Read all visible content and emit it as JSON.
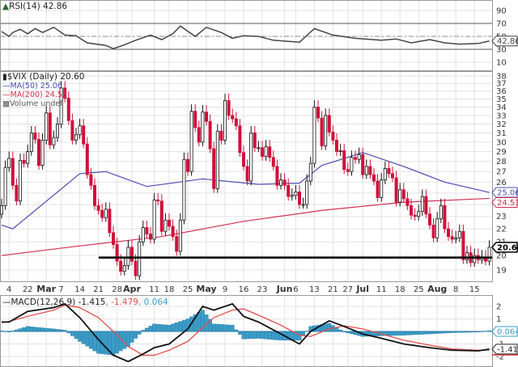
{
  "chart_data": [
    {
      "type": "line",
      "panel": "RSI",
      "title": "RSI(14) 42.86",
      "ylim": [
        0,
        100
      ],
      "yticks": [
        90,
        70,
        50,
        30,
        10
      ],
      "reference_lines": [
        70,
        30
      ],
      "last_value": "42.86",
      "series": [
        {
          "values": [
            [
              "02-10",
              57.5
            ],
            [
              "02-14",
              50
            ],
            [
              "02-15",
              56
            ],
            [
              "02-17",
              61
            ],
            [
              "02-22",
              54
            ],
            [
              "02-24",
              62
            ],
            [
              "02-28",
              56
            ],
            [
              "03-03",
              64
            ],
            [
              "03-08",
              52
            ],
            [
              "03-11",
              51
            ],
            [
              "03-16",
              40
            ],
            [
              "03-23",
              36
            ],
            [
              "03-25",
              31
            ],
            [
              "03-30",
              37
            ],
            [
              "04-04",
              44
            ],
            [
              "04-08",
              52
            ],
            [
              "04-13",
              45
            ],
            [
              "04-19",
              54
            ],
            [
              "04-21",
              66
            ],
            [
              "04-27",
              50
            ],
            [
              "05-02",
              64
            ],
            [
              "05-06",
              56
            ],
            [
              "05-11",
              47
            ],
            [
              "05-16",
              51
            ],
            [
              "05-20",
              50
            ],
            [
              "05-26",
              44
            ],
            [
              "06-07",
              41
            ],
            [
              "06-13",
              62
            ],
            [
              "06-21",
              52
            ],
            [
              "06-29",
              47
            ],
            [
              "07-11",
              44
            ],
            [
              "07-15",
              46
            ],
            [
              "07-21",
              40
            ],
            [
              "07-28",
              45
            ],
            [
              "08-03",
              40
            ],
            [
              "08-09",
              38
            ],
            [
              "08-16",
              39
            ],
            [
              "08-19",
              42.86
            ]
          ]
        }
      ]
    },
    {
      "type": "candlestick",
      "panel": "price",
      "title": "$VIX (Daily) 20.60",
      "scale": "log",
      "ylim": [
        18.6,
        38.5
      ],
      "yticks": [
        19,
        20,
        21,
        22,
        23,
        24,
        25,
        26,
        27,
        28,
        29,
        30,
        31,
        32,
        33,
        34,
        35,
        36,
        37,
        38
      ],
      "grid": true,
      "last_value": "20.60",
      "support_line": 19.85,
      "legend": [
        {
          "label": "MA(50) 25.06",
          "color": "#4b4bb0"
        },
        {
          "label": "MA(200) 24.53",
          "color": "#d03050"
        },
        {
          "label": "Volume undef",
          "color": "#555555"
        }
      ],
      "ma50_tag": "25.06",
      "ma200_tag": "24.53",
      "closes": [
        [
          "02-10",
          23.9
        ],
        [
          "02-11",
          27.4
        ],
        [
          "02-14",
          28.3
        ],
        [
          "02-15",
          25.7
        ],
        [
          "02-16",
          24.3
        ],
        [
          "02-17",
          28.1
        ],
        [
          "02-18",
          27.8
        ],
        [
          "02-22",
          29.0
        ],
        [
          "02-23",
          31.0
        ],
        [
          "02-24",
          30.3
        ],
        [
          "02-25",
          27.6
        ],
        [
          "02-28",
          30.2
        ],
        [
          "03-01",
          33.3
        ],
        [
          "03-02",
          29.7
        ],
        [
          "03-03",
          30.5
        ],
        [
          "03-04",
          32.0
        ],
        [
          "03-07",
          36.4
        ],
        [
          "03-08",
          35.1
        ],
        [
          "03-09",
          32.4
        ],
        [
          "03-10",
          30.2
        ],
        [
          "03-11",
          30.8
        ],
        [
          "03-14",
          31.8
        ],
        [
          "03-15",
          29.8
        ],
        [
          "03-16",
          26.7
        ],
        [
          "03-17",
          25.7
        ],
        [
          "03-18",
          23.9
        ],
        [
          "03-21",
          23.5
        ],
        [
          "03-22",
          22.9
        ],
        [
          "03-23",
          23.6
        ],
        [
          "03-24",
          21.7
        ],
        [
          "03-25",
          20.8
        ],
        [
          "03-28",
          19.6
        ],
        [
          "03-29",
          18.9
        ],
        [
          "03-30",
          19.3
        ],
        [
          "03-31",
          20.6
        ],
        [
          "04-01",
          19.6
        ],
        [
          "04-04",
          18.6
        ],
        [
          "04-05",
          21.0
        ],
        [
          "04-06",
          22.1
        ],
        [
          "04-07",
          21.6
        ],
        [
          "04-08",
          21.2
        ],
        [
          "04-11",
          24.4
        ],
        [
          "04-12",
          24.3
        ],
        [
          "04-13",
          21.8
        ],
        [
          "04-14",
          22.7
        ],
        [
          "04-18",
          22.2
        ],
        [
          "04-19",
          21.4
        ],
        [
          "04-20",
          20.3
        ],
        [
          "04-21",
          22.7
        ],
        [
          "04-22",
          28.2
        ],
        [
          "04-25",
          27.0
        ],
        [
          "04-26",
          33.5
        ],
        [
          "04-27",
          31.6
        ],
        [
          "04-28",
          30.0
        ],
        [
          "04-29",
          33.4
        ],
        [
          "05-02",
          32.3
        ],
        [
          "05-03",
          29.3
        ],
        [
          "05-04",
          25.4
        ],
        [
          "05-05",
          31.2
        ],
        [
          "05-06",
          30.2
        ],
        [
          "05-09",
          34.8
        ],
        [
          "05-10",
          33.0
        ],
        [
          "05-11",
          32.6
        ],
        [
          "05-12",
          31.8
        ],
        [
          "05-13",
          28.9
        ],
        [
          "05-16",
          27.5
        ],
        [
          "05-17",
          26.1
        ],
        [
          "05-18",
          31.0
        ],
        [
          "05-19",
          29.4
        ],
        [
          "05-20",
          29.4
        ],
        [
          "05-23",
          28.5
        ],
        [
          "05-24",
          29.5
        ],
        [
          "05-25",
          28.4
        ],
        [
          "05-26",
          27.5
        ],
        [
          "05-27",
          25.7
        ],
        [
          "05-31",
          26.2
        ],
        [
          "06-01",
          25.7
        ],
        [
          "06-02",
          24.7
        ],
        [
          "06-03",
          24.8
        ],
        [
          "06-06",
          25.1
        ],
        [
          "06-07",
          24.0
        ],
        [
          "06-08",
          24.0
        ],
        [
          "06-09",
          26.1
        ],
        [
          "06-10",
          27.8
        ],
        [
          "06-13",
          34.0
        ],
        [
          "06-14",
          32.7
        ],
        [
          "06-15",
          29.6
        ],
        [
          "06-16",
          33.0
        ],
        [
          "06-17",
          31.1
        ],
        [
          "06-21",
          30.2
        ],
        [
          "06-22",
          29.0
        ],
        [
          "06-23",
          29.1
        ],
        [
          "06-24",
          27.2
        ],
        [
          "06-27",
          27.0
        ],
        [
          "06-28",
          28.4
        ],
        [
          "06-29",
          28.2
        ],
        [
          "06-30",
          28.7
        ],
        [
          "07-01",
          26.7
        ],
        [
          "07-05",
          27.5
        ],
        [
          "07-06",
          26.7
        ],
        [
          "07-07",
          26.1
        ],
        [
          "07-08",
          24.6
        ],
        [
          "07-11",
          26.2
        ],
        [
          "07-12",
          27.3
        ],
        [
          "07-13",
          26.8
        ],
        [
          "07-14",
          26.4
        ],
        [
          "07-15",
          24.2
        ],
        [
          "07-18",
          25.3
        ],
        [
          "07-19",
          24.5
        ],
        [
          "07-20",
          23.9
        ],
        [
          "07-21",
          23.1
        ],
        [
          "07-22",
          23.0
        ],
        [
          "07-25",
          23.4
        ],
        [
          "07-26",
          24.7
        ],
        [
          "07-27",
          23.2
        ],
        [
          "07-28",
          22.3
        ],
        [
          "07-29",
          21.3
        ],
        [
          "08-01",
          22.8
        ],
        [
          "08-02",
          23.9
        ],
        [
          "08-03",
          22.0
        ],
        [
          "08-04",
          21.4
        ],
        [
          "08-05",
          21.2
        ],
        [
          "08-08",
          21.3
        ],
        [
          "08-09",
          21.8
        ],
        [
          "08-10",
          19.7
        ],
        [
          "08-11",
          20.2
        ],
        [
          "08-12",
          19.5
        ],
        [
          "08-15",
          20.0
        ],
        [
          "08-16",
          19.7
        ],
        [
          "08-17",
          19.9
        ],
        [
          "08-18",
          19.6
        ],
        [
          "08-19",
          20.6
        ]
      ],
      "ma50": [
        [
          "02-10",
          22.3
        ],
        [
          "02-15",
          22.0
        ],
        [
          "03-14",
          26.8
        ],
        [
          "03-23",
          27.0
        ],
        [
          "04-07",
          25.6
        ],
        [
          "04-29",
          26.3
        ],
        [
          "05-20",
          25.8
        ],
        [
          "06-07",
          25.9
        ],
        [
          "06-15",
          27.6
        ],
        [
          "07-01",
          28.9
        ],
        [
          "07-19",
          27.5
        ],
        [
          "08-03",
          26.0
        ],
        [
          "08-19",
          25.06
        ]
      ],
      "ma200": [
        [
          "02-10",
          20.0
        ],
        [
          "03-14",
          20.7
        ],
        [
          "04-13",
          21.4
        ],
        [
          "05-16",
          22.6
        ],
        [
          "06-15",
          23.5
        ],
        [
          "07-19",
          24.2
        ],
        [
          "08-19",
          24.53
        ]
      ],
      "x_labels": [
        [
          "4",
          "02-14",
          false
        ],
        [
          "22",
          "02-22",
          false
        ],
        [
          "Mar",
          "03-01",
          true
        ],
        [
          "7",
          "03-07",
          false
        ],
        [
          "14",
          "03-14",
          false
        ],
        [
          "21",
          "03-21",
          false
        ],
        [
          "28",
          "03-28",
          false
        ],
        [
          "Apr",
          "04-01",
          true
        ],
        [
          "11",
          "04-11",
          false
        ],
        [
          "18",
          "04-18",
          false
        ],
        [
          "25",
          "04-25",
          false
        ],
        [
          "May",
          "05-02",
          true
        ],
        [
          "9",
          "05-09",
          false
        ],
        [
          "16",
          "05-16",
          false
        ],
        [
          "23",
          "05-23",
          false
        ],
        [
          "Jun",
          "06-01",
          true
        ],
        [
          "6",
          "06-06",
          false
        ],
        [
          "13",
          "06-13",
          false
        ],
        [
          "21",
          "06-21",
          false
        ],
        [
          "27",
          "06-27",
          false
        ],
        [
          "Jul",
          "07-01",
          true
        ],
        [
          "11",
          "07-11",
          false
        ],
        [
          "18",
          "07-18",
          false
        ],
        [
          "25",
          "07-25",
          false
        ],
        [
          "Aug",
          "08-01",
          true
        ],
        [
          "8",
          "08-08",
          false
        ],
        [
          "15",
          "08-15",
          false
        ]
      ]
    },
    {
      "type": "line",
      "panel": "MACD",
      "title_prefix": "MACD(12,26,9) -1.415",
      "signal_label": ", -1.479",
      "hist_label": ", 0.064",
      "ylim": [
        -2.6,
        2.7
      ],
      "yticks": [
        2,
        1,
        -1,
        -2
      ],
      "macd_tag": "-1.415",
      "hist_tag": "0.064",
      "series": [
        {
          "name": "MACD",
          "color": "#111111",
          "values": [
            [
              "02-10",
              0.75
            ],
            [
              "02-14",
              0.75
            ],
            [
              "02-22",
              1.6
            ],
            [
              "03-03",
              1.9
            ],
            [
              "03-08",
              2.2
            ],
            [
              "03-14",
              1.1
            ],
            [
              "03-21",
              -0.65
            ],
            [
              "03-25",
              -1.9
            ],
            [
              "03-31",
              -2.4
            ],
            [
              "04-06",
              -1.8
            ],
            [
              "04-11",
              -1.3
            ],
            [
              "04-18",
              -1.0
            ],
            [
              "04-25",
              0.2
            ],
            [
              "04-29",
              2.0
            ],
            [
              "05-04",
              1.7
            ],
            [
              "05-11",
              2.2
            ],
            [
              "05-16",
              1.2
            ],
            [
              "05-20",
              0.75
            ],
            [
              "05-31",
              -0.2
            ],
            [
              "06-07",
              -1.0
            ],
            [
              "06-10",
              0.0
            ],
            [
              "06-17",
              0.85
            ],
            [
              "06-24",
              0.4
            ],
            [
              "07-01",
              -0.2
            ],
            [
              "07-11",
              -0.55
            ],
            [
              "07-19",
              -1.0
            ],
            [
              "07-28",
              -1.3
            ],
            [
              "08-05",
              -1.5
            ],
            [
              "08-16",
              -1.55
            ],
            [
              "08-19",
              -1.415
            ]
          ]
        },
        {
          "name": "Signal",
          "color": "#e05050",
          "values": [
            [
              "02-10",
              0.7
            ],
            [
              "02-14",
              0.8
            ],
            [
              "02-22",
              1.2
            ],
            [
              "03-03",
              1.7
            ],
            [
              "03-08",
              2.1
            ],
            [
              "03-14",
              1.9
            ],
            [
              "03-21",
              1.1
            ],
            [
              "03-25",
              0.0
            ],
            [
              "03-31",
              -1.2
            ],
            [
              "04-06",
              -1.9
            ],
            [
              "04-11",
              -1.9
            ],
            [
              "04-18",
              -1.5
            ],
            [
              "04-25",
              -0.8
            ],
            [
              "04-29",
              0.3
            ],
            [
              "05-04",
              1.1
            ],
            [
              "05-11",
              1.7
            ],
            [
              "05-16",
              1.8
            ],
            [
              "05-20",
              1.3
            ],
            [
              "05-31",
              0.5
            ],
            [
              "06-07",
              -0.3
            ],
            [
              "06-10",
              -0.4
            ],
            [
              "06-17",
              0.2
            ],
            [
              "06-24",
              0.45
            ],
            [
              "07-01",
              0.2
            ],
            [
              "07-11",
              -0.2
            ],
            [
              "07-19",
              -0.7
            ],
            [
              "07-28",
              -1.1
            ],
            [
              "08-05",
              -1.4
            ],
            [
              "08-16",
              -1.5
            ],
            [
              "08-19",
              -1.479
            ]
          ]
        }
      ],
      "histogram_color": "#3a9cc8"
    }
  ],
  "colors": {
    "up": "#111111",
    "down": "#d0103a",
    "ma50": "#4b4bb0",
    "ma200": "#d03050",
    "hist": "#3a9cc8",
    "grid": "#e2e2e2"
  }
}
